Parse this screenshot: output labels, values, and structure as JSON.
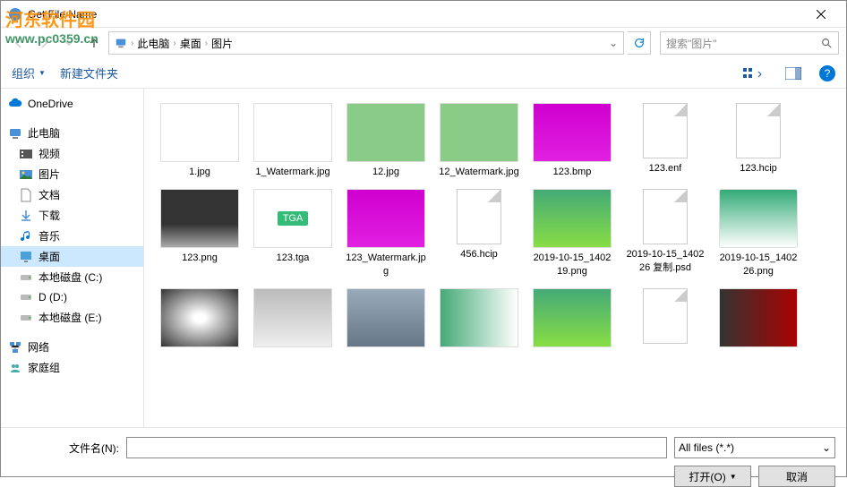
{
  "watermark": {
    "main": "河东软件园",
    "sub": "www.pc0359.cn"
  },
  "window": {
    "title": "Get File Name"
  },
  "nav": {
    "breadcrumb": [
      "此电脑",
      "桌面",
      "图片"
    ],
    "search_placeholder": "搜索\"图片\""
  },
  "toolbar": {
    "organize": "组织",
    "newfolder": "新建文件夹"
  },
  "sidebar": {
    "items": [
      {
        "label": "OneDrive",
        "icon": "cloud",
        "level": 1
      },
      {
        "sep": true
      },
      {
        "label": "此电脑",
        "icon": "pc",
        "level": 1
      },
      {
        "label": "视频",
        "icon": "video",
        "level": 2
      },
      {
        "label": "图片",
        "icon": "pictures",
        "level": 2
      },
      {
        "label": "文档",
        "icon": "docs",
        "level": 2
      },
      {
        "label": "下载",
        "icon": "downloads",
        "level": 2
      },
      {
        "label": "音乐",
        "icon": "music",
        "level": 2
      },
      {
        "label": "桌面",
        "icon": "desktop",
        "level": 2,
        "selected": true
      },
      {
        "label": "本地磁盘 (C:)",
        "icon": "drive",
        "level": 2
      },
      {
        "label": "D (D:)",
        "icon": "drive",
        "level": 2
      },
      {
        "label": "本地磁盘 (E:)",
        "icon": "drive",
        "level": 2
      },
      {
        "sep": true
      },
      {
        "label": "网络",
        "icon": "network",
        "level": 1
      },
      {
        "label": "家庭组",
        "icon": "homegroup",
        "level": 1
      }
    ]
  },
  "files": [
    {
      "name": "1.jpg",
      "thumb": "white"
    },
    {
      "name": "1_Watermark.jpg",
      "thumb": "white"
    },
    {
      "name": "12.jpg",
      "thumb": "collage"
    },
    {
      "name": "12_Watermark.jpg",
      "thumb": "collage"
    },
    {
      "name": "123.bmp",
      "thumb": "magenta"
    },
    {
      "name": "123.enf",
      "thumb": "doc"
    },
    {
      "name": "123.hcip",
      "thumb": "doc"
    },
    {
      "name": "123.png",
      "thumb": "bw"
    },
    {
      "name": "123.tga",
      "thumb": "tga"
    },
    {
      "name": "123_Watermark.jpg",
      "thumb": "magenta"
    },
    {
      "name": "456.hcip",
      "thumb": "doc"
    },
    {
      "name": "2019-10-15_140219.png",
      "thumb": "green"
    },
    {
      "name": "2019-10-15_140226 复制.psd",
      "thumb": "doc"
    },
    {
      "name": "2019-10-15_140226.png",
      "thumb": "globe"
    },
    {
      "name": "",
      "thumb": "dandelion"
    },
    {
      "name": "",
      "thumb": "gray"
    },
    {
      "name": "",
      "thumb": "wolf"
    },
    {
      "name": "",
      "thumb": "green2"
    },
    {
      "name": "",
      "thumb": "green"
    },
    {
      "name": "",
      "thumb": "doc"
    },
    {
      "name": "",
      "thumb": "car"
    }
  ],
  "footer": {
    "filename_label": "文件名(N):",
    "filename_value": "",
    "filter": "All files (*.*)",
    "open": "打开(O)",
    "cancel": "取消"
  }
}
